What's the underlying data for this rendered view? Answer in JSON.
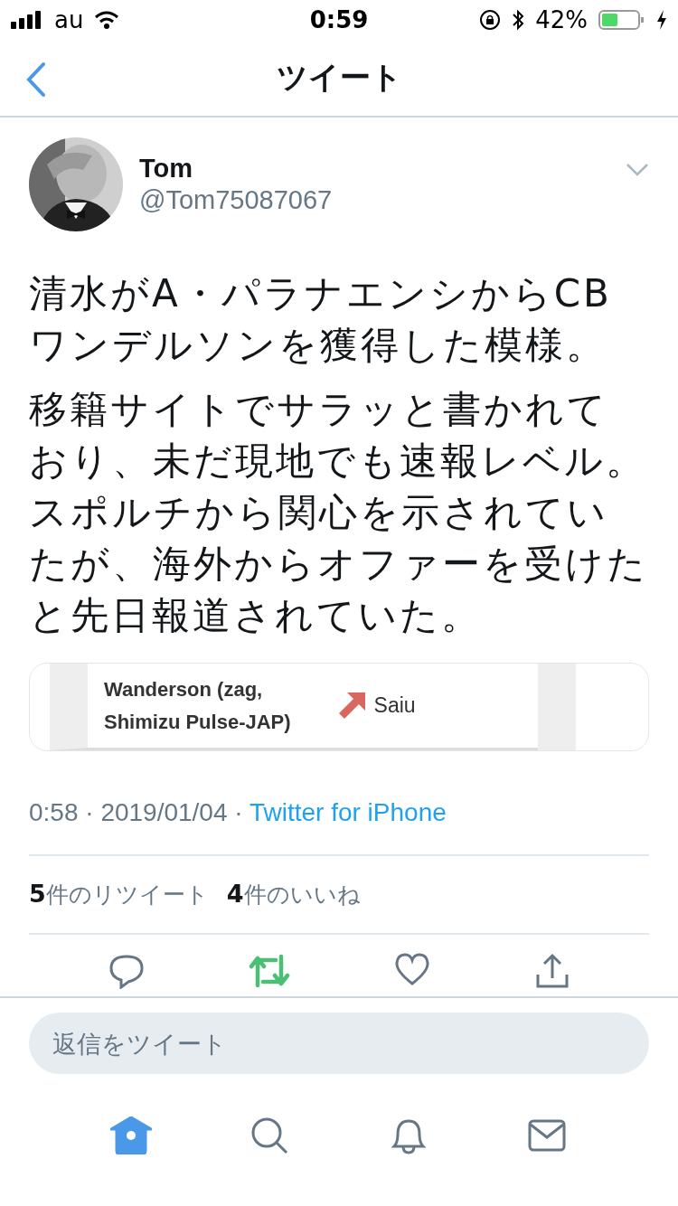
{
  "status_bar": {
    "carrier": "au",
    "time": "0:59",
    "battery": "42%"
  },
  "nav": {
    "title": "ツイート"
  },
  "tweet": {
    "name": "Tom",
    "handle": "@Tom75087067",
    "paragraphs": [
      [
        "清水がA・パラナエンシからCBワンデルソンを獲得した模様。"
      ],
      [
        "移籍サイトでサラッと書かれており、未だ現地でも速報レベル。",
        "スポルチから関心を示されていたが、海外からオファーを受けたと先日報道されていた。"
      ]
    ],
    "card": {
      "player": "Wanderson (zag,\nShimizu Pulse-JAP)",
      "status": "Saiu"
    },
    "time": "0:58 · 2019/01/04 · ",
    "source": "Twitter for iPhone",
    "stats": [
      "**5**件のリツイート",
      "**4**件のいいね"
    ],
    "retweeted": true,
    "liked": false
  },
  "reply": {
    "placeholder": "返信をツイート"
  },
  "tabs": [
    {
      "kind": "home",
      "selected": true
    },
    {
      "kind": "search",
      "selected": false
    },
    {
      "kind": "notifications",
      "selected": false
    },
    {
      "kind": "messages",
      "selected": false
    }
  ]
}
